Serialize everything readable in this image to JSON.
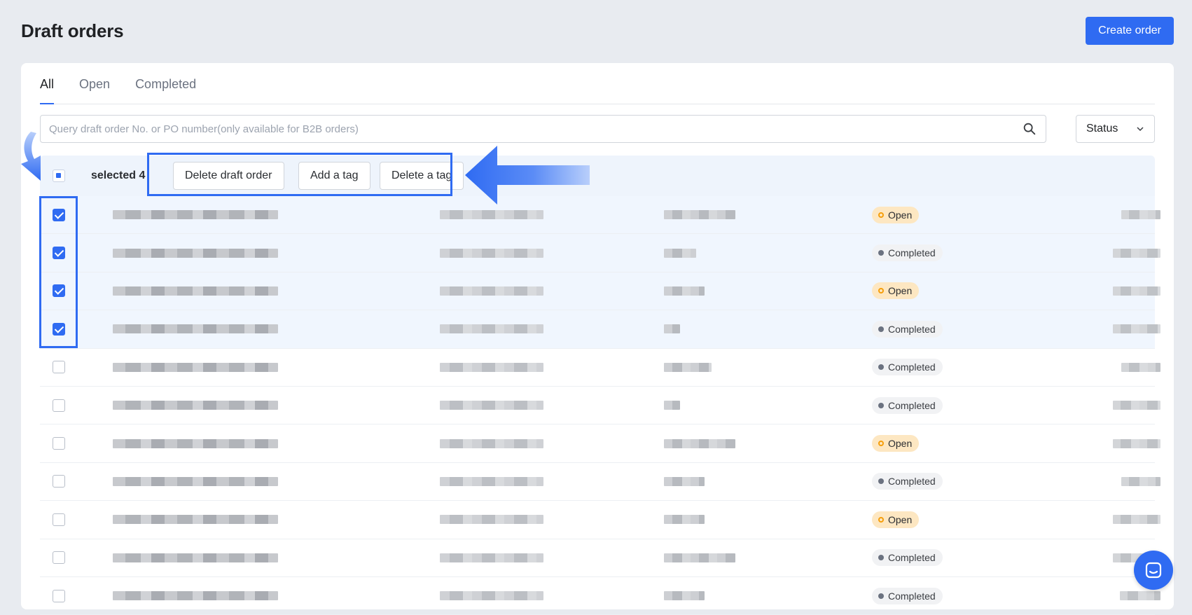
{
  "page": {
    "title": "Draft orders",
    "create_button": "Create order"
  },
  "tabs": [
    {
      "label": "All",
      "active": true
    },
    {
      "label": "Open",
      "active": false
    },
    {
      "label": "Completed",
      "active": false
    }
  ],
  "search": {
    "placeholder": "Query draft order No. or PO number(only available for B2B orders)",
    "icon": "search-icon"
  },
  "status_filter": {
    "label": "Status",
    "icon": "chevron-down-icon"
  },
  "bulk_actions": {
    "selected_label": "selected 4",
    "buttons": [
      "Delete draft order",
      "Add a tag",
      "Delete a tag"
    ]
  },
  "rows": [
    {
      "selected": true,
      "status": "Open"
    },
    {
      "selected": true,
      "status": "Completed"
    },
    {
      "selected": true,
      "status": "Open"
    },
    {
      "selected": true,
      "status": "Completed"
    },
    {
      "selected": false,
      "status": "Completed"
    },
    {
      "selected": false,
      "status": "Completed"
    },
    {
      "selected": false,
      "status": "Open"
    },
    {
      "selected": false,
      "status": "Completed"
    },
    {
      "selected": false,
      "status": "Open"
    },
    {
      "selected": false,
      "status": "Completed"
    },
    {
      "selected": false,
      "status": "Completed"
    }
  ],
  "colors": {
    "accent": "#2f6bf2",
    "open_badge": "#fde7c2",
    "completed_badge": "#f1f2f4"
  }
}
